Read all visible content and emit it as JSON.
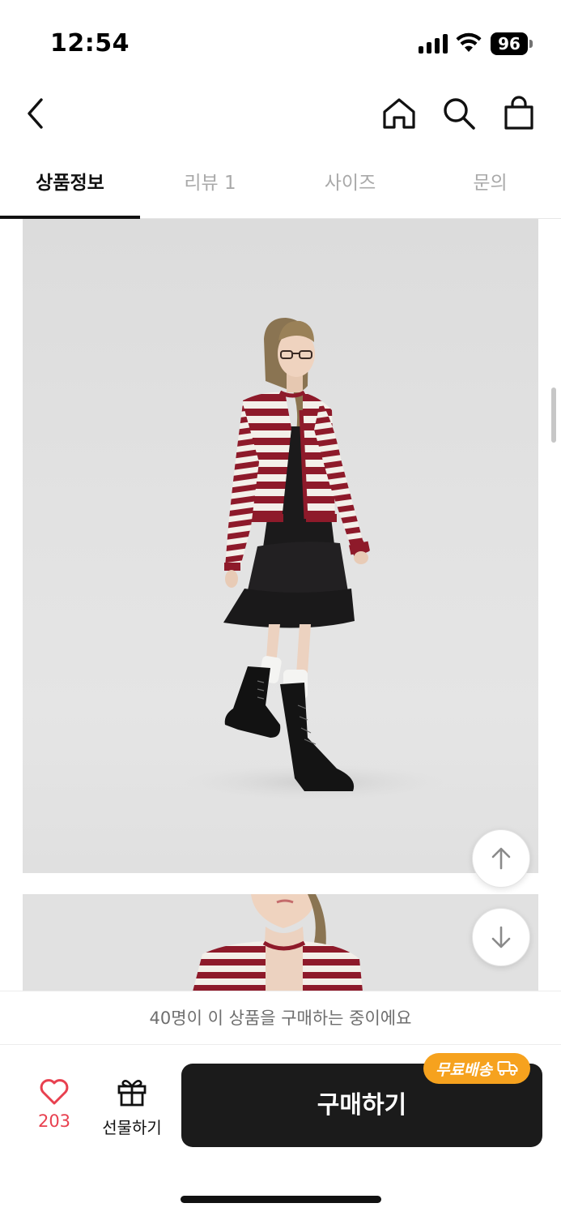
{
  "status_bar": {
    "time": "12:54",
    "battery": "96"
  },
  "nav": {
    "back_icon": "chevron-left-icon",
    "home_icon": "home-icon",
    "search_icon": "search-icon",
    "cart_icon": "shopping-bag-icon"
  },
  "tabs": [
    {
      "label": "상품정보",
      "active": true
    },
    {
      "label": "리뷰 1",
      "active": false
    },
    {
      "label": "사이즈",
      "active": false
    },
    {
      "label": "문의",
      "active": false
    }
  ],
  "images": [
    {
      "description_icon": "product-photo-full-body"
    },
    {
      "description_icon": "product-photo-detail"
    }
  ],
  "float_buttons": {
    "up_icon": "arrow-up-icon",
    "down_icon": "arrow-down-icon"
  },
  "buying_notice": "40명이 이 상품을 구매하는 중이에요",
  "actions": {
    "like_count": "203",
    "gift_label": "선물하기",
    "buy_label": "구매하기",
    "free_shipping_badge": "무료배송"
  },
  "colors": {
    "accent_red": "#e8404f",
    "badge_orange": "#f6a21e",
    "buy_button": "#1b1b1b",
    "cardigan_red": "#8e1a2a"
  }
}
